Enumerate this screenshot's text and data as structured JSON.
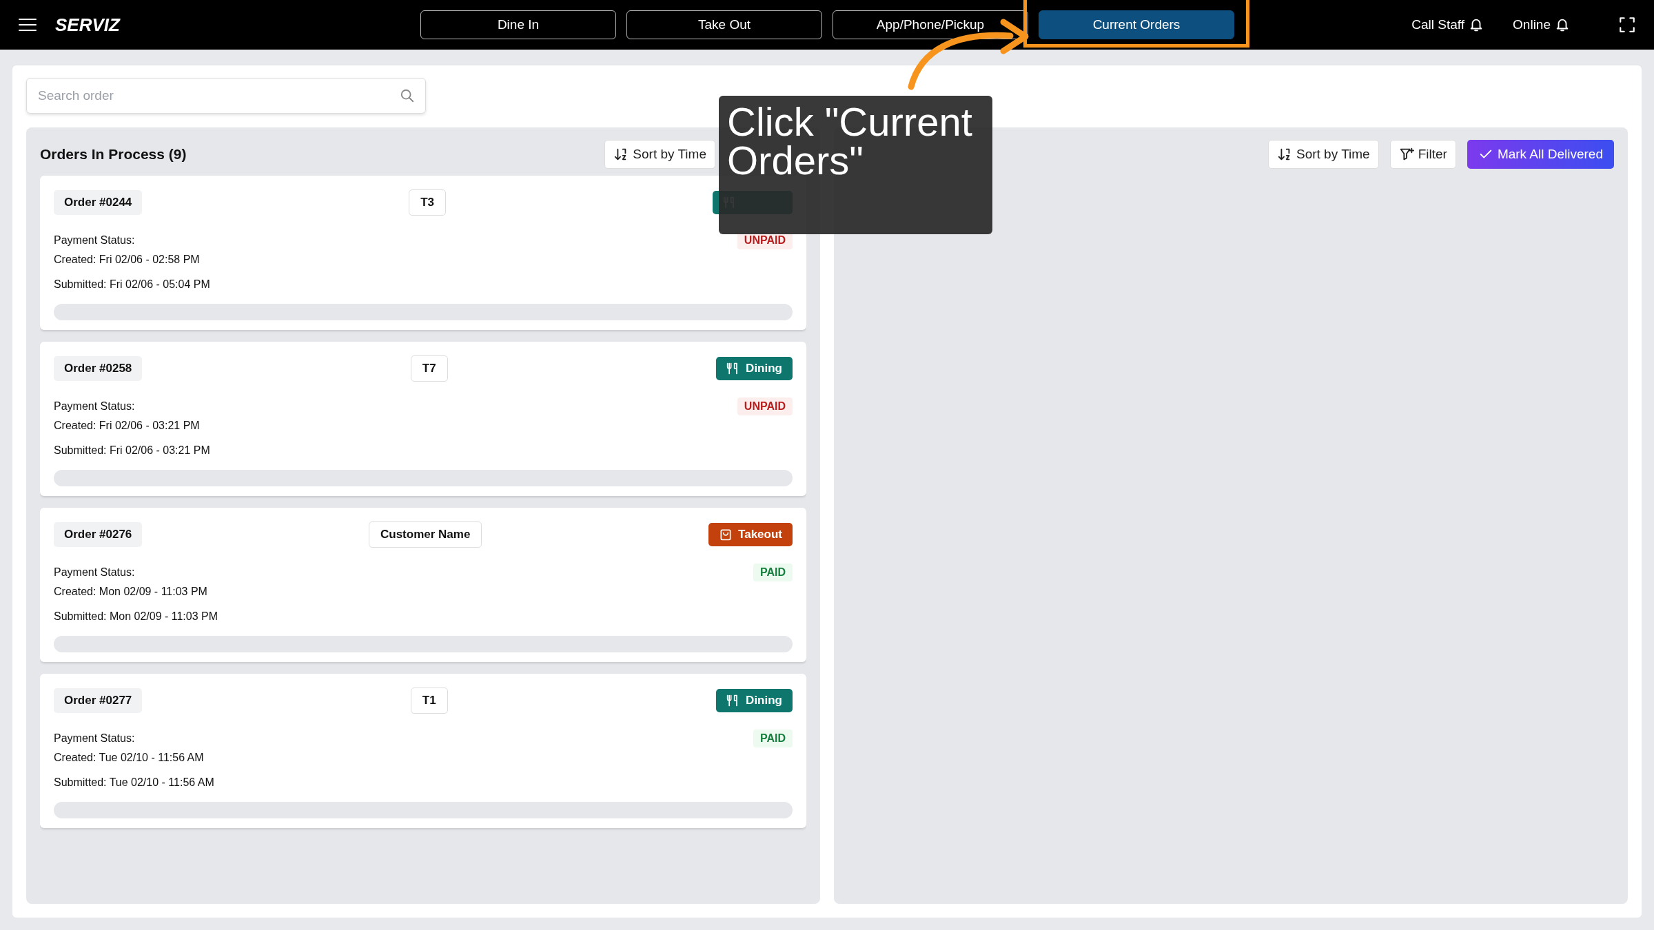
{
  "topbar": {
    "brand": "SERVIZ",
    "tabs": [
      {
        "label": "Dine In",
        "selected": false
      },
      {
        "label": "Take Out",
        "selected": false
      },
      {
        "label": "App/Phone/Pickup",
        "selected": false
      },
      {
        "label": "Current Orders",
        "selected": true
      }
    ],
    "actions": [
      {
        "label": "Call Staff"
      },
      {
        "label": "Online"
      }
    ]
  },
  "search": {
    "placeholder": "Search order"
  },
  "panels": [
    {
      "title": "Orders In Process (9)",
      "buttons": [
        {
          "kind": "sort",
          "label": "Sort by Time"
        }
      ],
      "orders": [
        {
          "number": "Order #0244",
          "table": "T3",
          "kind": "dining",
          "payment_label": "Payment Status:",
          "paid": false,
          "payment": "UNPAID",
          "created": "Created: Fri 02/06 - 02:58 PM",
          "submitted": "Submitted: Fri 02/06 - 05:04 PM"
        },
        {
          "number": "Order #0258",
          "table": "T7",
          "kind": "dining",
          "type_label": "Dining",
          "payment_label": "Payment Status:",
          "paid": false,
          "payment": "UNPAID",
          "created": "Created: Fri 02/06 - 03:21 PM",
          "submitted": "Submitted: Fri 02/06 - 03:21 PM"
        },
        {
          "number": "Order #0276",
          "table": "Customer Name",
          "kind": "takeout",
          "type_label": "Takeout",
          "payment_label": "Payment Status:",
          "paid": true,
          "payment": "PAID",
          "created": "Created: Mon 02/09 - 11:03 PM",
          "submitted": "Submitted: Mon 02/09 - 11:03 PM"
        },
        {
          "number": "Order #0277",
          "table": "T1",
          "kind": "dining",
          "type_label": "Dining",
          "payment_label": "Payment Status:",
          "paid": true,
          "payment": "PAID",
          "created": "Created: Tue 02/10 - 11:56 AM",
          "submitted": "Submitted: Tue 02/10 - 11:56 AM"
        }
      ]
    },
    {
      "buttons": [
        {
          "kind": "sort",
          "label": "Sort by Time"
        },
        {
          "kind": "filter",
          "label": "Filter"
        },
        {
          "kind": "deliver",
          "label": "Mark All Delivered"
        }
      ]
    }
  ],
  "callout": {
    "text": "Click \"Current Orders\""
  }
}
